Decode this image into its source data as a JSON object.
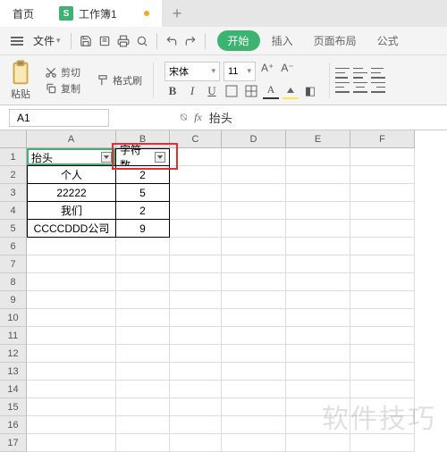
{
  "tabs": {
    "home": "首页",
    "workbook": "工作簿1"
  },
  "menubar": {
    "file": "文件"
  },
  "ribbon": {
    "start": "开始",
    "insert": "插入",
    "page_layout": "页面布局",
    "formula": "公式"
  },
  "toolbar": {
    "paste": "粘贴",
    "cut": "剪切",
    "copy": "复制",
    "format_painter": "格式刷",
    "font_name": "宋体",
    "font_size": "11"
  },
  "namebox": {
    "ref": "A1"
  },
  "formula_bar": {
    "value": "抬头"
  },
  "columns": [
    "A",
    "B",
    "C",
    "D",
    "E",
    "F"
  ],
  "rows": [
    "1",
    "2",
    "3",
    "4",
    "5",
    "6",
    "7",
    "8",
    "9",
    "10",
    "11",
    "12",
    "13",
    "14",
    "15",
    "16",
    "17"
  ],
  "col_widths": {
    "A": 100,
    "B": 60,
    "C": 58,
    "D": 72,
    "E": 72,
    "F": 72
  },
  "table": {
    "header": {
      "A": "抬头",
      "B": "字符数"
    },
    "rows": [
      {
        "A": "个人",
        "B": "2"
      },
      {
        "A": "22222",
        "B": "5"
      },
      {
        "A": "我们",
        "B": "2"
      },
      {
        "A": "CCCCDDD公司",
        "B": "9"
      }
    ]
  },
  "highlight": {
    "cell": "B1",
    "color": "#e03030"
  },
  "watermark": "软件技巧",
  "chart_data": {
    "type": "table",
    "title": "",
    "columns": [
      "抬头",
      "字符数"
    ],
    "rows": [
      [
        "个人",
        2
      ],
      [
        "22222",
        5
      ],
      [
        "我们",
        2
      ],
      [
        "CCCCDDD公司",
        9
      ]
    ]
  }
}
